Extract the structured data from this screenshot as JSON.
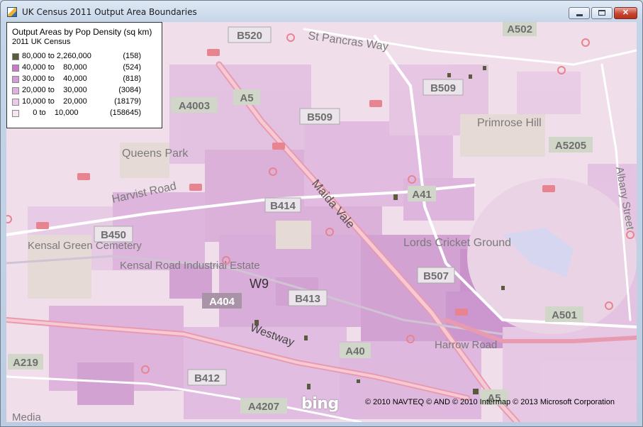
{
  "window": {
    "title": "UK Census 2011 Output Area Boundaries",
    "minimize": "minimize",
    "maximize": "maximize",
    "close": "close"
  },
  "legend": {
    "title": "Output Areas by Pop Density (sq km)",
    "subtitle": "2011 UK Census",
    "rows": [
      {
        "range": "80,000 to 2,260,000",
        "count": "(158)",
        "color": "#5a5a3c"
      },
      {
        "range": "40,000 to    80,000",
        "count": "(524)",
        "color": "#c77bc9"
      },
      {
        "range": "30,000 to    40,000",
        "count": "(818)",
        "color": "#d39bd4"
      },
      {
        "range": "20,000 to    30,000",
        "count": "(3084)",
        "color": "#deb2de"
      },
      {
        "range": "10,000 to    20,000",
        "count": "(18179)",
        "color": "#e9cbe8"
      },
      {
        "range": "     0 to    10,000",
        "count": "(158645)",
        "color": "#f6e6f2"
      }
    ]
  },
  "map": {
    "road_shields": [
      "B520",
      "A502",
      "B509",
      "A5",
      "A4003",
      "B509",
      "A5205",
      "B414",
      "A41",
      "B450",
      "B507",
      "A404",
      "B413",
      "A501",
      "A40",
      "A219",
      "B412",
      "A4207",
      "A5"
    ],
    "place_labels": [
      "St Pancras Way",
      "Primrose Hill",
      "Queens Park",
      "Harvist Road",
      "Maida Vale",
      "Lords Cricket Ground",
      "Kensal Green Cemetery",
      "Kensal Road Industrial Estate",
      "W9",
      "Westway",
      "Harrow Road",
      "Albany Street",
      "Media"
    ],
    "station_icon": "rail-station-icon",
    "tube_icon": "underground-icon"
  },
  "attribution": {
    "logo": "bing",
    "copyright": "© 2010 NAVTEQ © AND © 2010 Intermap © 2013 Microsoft Corporation"
  }
}
